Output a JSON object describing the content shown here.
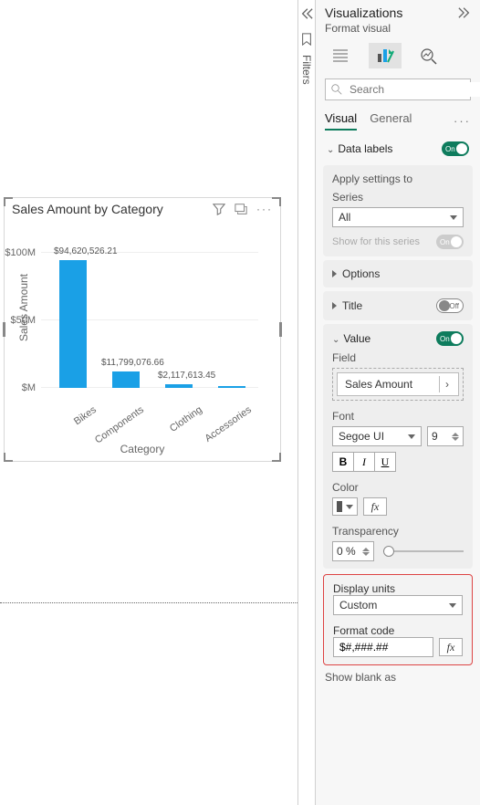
{
  "sidebar": {
    "title": "Visualizations",
    "subtitle": "Format visual",
    "search_placeholder": "Search",
    "tabs": {
      "visual": "Visual",
      "general": "General"
    }
  },
  "sections": {
    "data_labels": "Data labels",
    "apply_settings": "Apply settings to",
    "series": "Series",
    "series_value": "All",
    "show_for_series": "Show for this series",
    "options": "Options",
    "title": "Title",
    "value": "Value",
    "field": "Field",
    "field_value": "Sales Amount",
    "font": "Font",
    "font_family": "Segoe UI",
    "font_size": "9",
    "color": "Color",
    "transparency": "Transparency",
    "transparency_value": "0 %",
    "display_units": "Display units",
    "display_units_value": "Custom",
    "format_code": "Format code",
    "format_code_value": "$#,###.##",
    "show_blank_as": "Show blank as",
    "on": "On",
    "off": "Off"
  },
  "filters_label": "Filters",
  "chart": {
    "title": "Sales Amount by Category",
    "ylabel": "Sales Amount",
    "xlabel": "Category"
  },
  "chart_data": {
    "type": "bar",
    "title": "Sales Amount by Category",
    "xlabel": "Category",
    "ylabel": "Sales Amount",
    "ylim": [
      0,
      100000000
    ],
    "yticks": [
      "$M",
      "$50M",
      "$100M"
    ],
    "categories": [
      "Bikes",
      "Components",
      "Clothing",
      "Accessories"
    ],
    "values": [
      94620526.21,
      11799076.66,
      2117613.45,
      700000
    ],
    "data_labels": [
      "$94,620,526.21",
      "$11,799,076.66",
      "$2,117,613.45",
      ""
    ]
  }
}
